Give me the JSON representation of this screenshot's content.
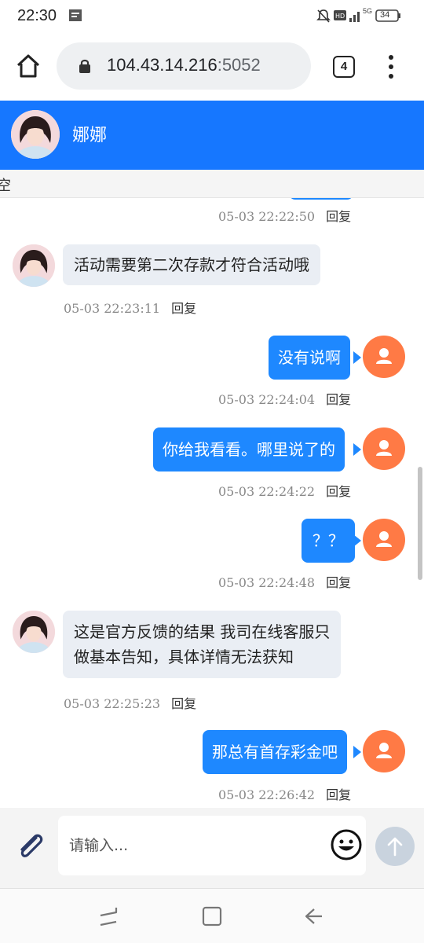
{
  "status_bar": {
    "time": "22:30",
    "network": "5G",
    "battery": "34"
  },
  "browser": {
    "url_host": "104.43.14.216",
    "url_port": ":5052",
    "tab_count": "4"
  },
  "chat_header": {
    "name": "娜娜"
  },
  "notice": {
    "text": "空"
  },
  "messages": [
    {
      "id": "m0",
      "side": "out",
      "text": "",
      "time": "05-03 22:22:50",
      "reply": "回复"
    },
    {
      "id": "m1",
      "side": "in",
      "text": "活动需要第二次存款才符合活动哦",
      "time": "05-03 22:23:11",
      "reply": "回复"
    },
    {
      "id": "m2",
      "side": "out",
      "text": "没有说啊",
      "time": "05-03 22:24:04",
      "reply": "回复"
    },
    {
      "id": "m3",
      "side": "out",
      "text": "你给我看看。哪里说了的",
      "time": "05-03 22:24:22",
      "reply": "回复"
    },
    {
      "id": "m4",
      "side": "out",
      "text": "？？",
      "time": "05-03 22:24:48",
      "reply": "回复"
    },
    {
      "id": "m5",
      "side": "in",
      "text_lines": [
        "这是官方反馈的结果 我司在线客服只",
        "做基本告知，具体详情无法获知"
      ],
      "time": "05-03 22:25:23",
      "reply": "回复"
    },
    {
      "id": "m6",
      "side": "out",
      "text": "那总有首存彩金吧",
      "time": "05-03 22:26:42",
      "reply": "回复"
    }
  ],
  "composer": {
    "placeholder": "请输入..."
  },
  "icons": {
    "home": "home-icon",
    "lock": "lock-icon",
    "tabs": "tabs-icon",
    "menu": "more-vert-icon",
    "attach": "paperclip-icon",
    "emoji": "smiley-icon",
    "send": "arrow-up-icon",
    "nav_recent": "recents-icon",
    "nav_home": "square-home-icon",
    "nav_back": "back-arrow-icon"
  },
  "colors": {
    "header_bg": "#1677ff",
    "bubble_out": "#1e88ff",
    "bubble_in": "#eaeef4",
    "user_avatar": "#ff7a45"
  }
}
